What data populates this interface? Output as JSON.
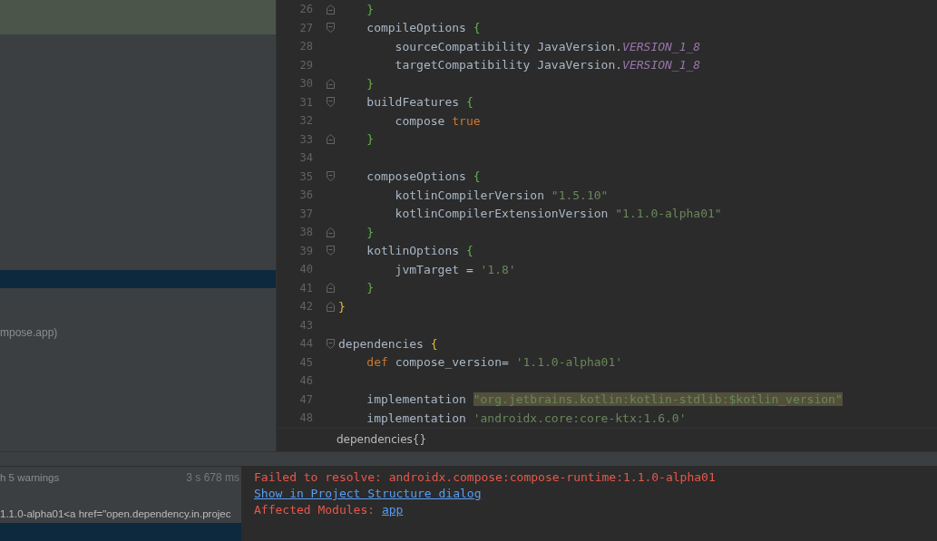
{
  "project_panel": {
    "selected_row": true,
    "item": "mpose.app)"
  },
  "editor": {
    "lines": [
      {
        "number": "26",
        "fold_end": true,
        "tokens": [
          {
            "kind": "brace",
            "text": "    }"
          }
        ]
      },
      {
        "number": "27",
        "fold_start": true,
        "tokens": [
          {
            "kind": "plain",
            "text": "    compileOptions "
          },
          {
            "kind": "brace",
            "text": "{"
          }
        ]
      },
      {
        "number": "28",
        "tokens": [
          {
            "kind": "plain",
            "text": "        sourceCompatibility JavaVersion."
          },
          {
            "kind": "const",
            "text": "VERSION_1_8"
          }
        ]
      },
      {
        "number": "29",
        "tokens": [
          {
            "kind": "plain",
            "text": "        targetCompatibility JavaVersion."
          },
          {
            "kind": "const",
            "text": "VERSION_1_8"
          }
        ]
      },
      {
        "number": "30",
        "fold_end": true,
        "tokens": [
          {
            "kind": "brace",
            "text": "    }"
          }
        ]
      },
      {
        "number": "31",
        "fold_start": true,
        "tokens": [
          {
            "kind": "plain",
            "text": "    buildFeatures "
          },
          {
            "kind": "brace",
            "text": "{"
          }
        ]
      },
      {
        "number": "32",
        "tokens": [
          {
            "kind": "plain",
            "text": "        compose "
          },
          {
            "kind": "keyword",
            "text": "true"
          }
        ]
      },
      {
        "number": "33",
        "fold_end": true,
        "tokens": [
          {
            "kind": "brace",
            "text": "    }"
          }
        ]
      },
      {
        "number": "34"
      },
      {
        "number": "35",
        "fold_start": true,
        "tokens": [
          {
            "kind": "plain",
            "text": "    composeOptions "
          },
          {
            "kind": "brace",
            "text": "{"
          }
        ]
      },
      {
        "number": "36",
        "tokens": [
          {
            "kind": "plain",
            "text": "        kotlinCompilerVersion "
          },
          {
            "kind": "string",
            "text": "\"1.5.10\""
          }
        ]
      },
      {
        "number": "37",
        "tokens": [
          {
            "kind": "plain",
            "text": "        kotlinCompilerExtensionVersion "
          },
          {
            "kind": "string",
            "text": "\"1.1.0-alpha01\""
          }
        ]
      },
      {
        "number": "38",
        "fold_end": true,
        "tokens": [
          {
            "kind": "brace",
            "text": "    }"
          }
        ]
      },
      {
        "number": "39",
        "fold_start": true,
        "tokens": [
          {
            "kind": "plain",
            "text": "    kotlinOptions "
          },
          {
            "kind": "brace",
            "text": "{"
          }
        ]
      },
      {
        "number": "40",
        "tokens": [
          {
            "kind": "plain",
            "text": "        jvmTarget = "
          },
          {
            "kind": "string",
            "text": "'1.8'"
          }
        ]
      },
      {
        "number": "41",
        "fold_end": true,
        "tokens": [
          {
            "kind": "brace",
            "text": "    }"
          }
        ]
      },
      {
        "number": "42",
        "fold_end": true,
        "tokens": [
          {
            "kind": "outer-brace",
            "text": "}"
          }
        ]
      },
      {
        "number": "43"
      },
      {
        "number": "44",
        "fold_start": true,
        "tokens": [
          {
            "kind": "plain",
            "text": "dependencies "
          },
          {
            "kind": "outer-brace",
            "text": "{"
          }
        ]
      },
      {
        "number": "45",
        "tokens": [
          {
            "kind": "keyword",
            "text": "    def "
          },
          {
            "kind": "plain",
            "text": "compose_version= "
          },
          {
            "kind": "string",
            "text": "'1.1.0-alpha01'"
          }
        ]
      },
      {
        "number": "46"
      },
      {
        "number": "47",
        "tokens": [
          {
            "kind": "plain",
            "text": "    implementation "
          },
          {
            "kind": "warn-string",
            "text": "\"org.jetbrains.kotlin:kotlin-stdlib:$kotlin_version\""
          }
        ]
      },
      {
        "number": "48",
        "tokens": [
          {
            "kind": "plain",
            "text": "    implementation "
          },
          {
            "kind": "string",
            "text": "'androidx.core:core-ktx:1.6.0'"
          }
        ]
      }
    ]
  },
  "breadcrumb": "dependencies{}",
  "build_tree": {
    "rows": [
      {
        "text": "h 5 warnings",
        "time": "3 s 678 ms",
        "selected": false
      },
      {
        "text": "1.1.0-alpha01<a href=\"open.dependency.in.projec",
        "selected": false
      },
      {
        "selected": true
      }
    ]
  },
  "console": {
    "error": "Failed to resolve: androidx.compose:compose-runtime:1.1.0-alpha01",
    "link": "Show in Project Structure dialog",
    "modules_label": "Affected Modules: ",
    "modules_link": "app"
  }
}
